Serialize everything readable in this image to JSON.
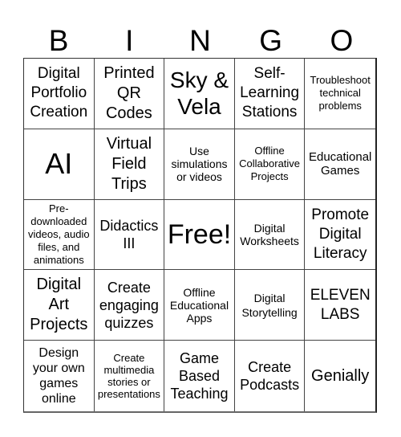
{
  "title_letters": [
    "B",
    "I",
    "N",
    "G",
    "O"
  ],
  "cells": [
    {
      "text": "Digital Portfolio Creation"
    },
    {
      "text": "Printed QR Codes"
    },
    {
      "text": "Sky & Vela"
    },
    {
      "text": "Self-Learning Stations"
    },
    {
      "text": "Troubleshoot technical problems"
    },
    {
      "text": "AI"
    },
    {
      "text": "Virtual Field Trips"
    },
    {
      "text": "Use simulations or videos"
    },
    {
      "text": "Offline Collaborative Projects"
    },
    {
      "text": "Educational Games"
    },
    {
      "text": "Pre-downloaded videos, audio files, and animations"
    },
    {
      "text": "Didactics III"
    },
    {
      "text": "Free!"
    },
    {
      "text": "Digital Worksheets"
    },
    {
      "text": "Promote Digital Literacy"
    },
    {
      "text": "Digital Art Projects"
    },
    {
      "text": "Create engaging quizzes"
    },
    {
      "text": "Offline Educational Apps"
    },
    {
      "text": "Digital Storytelling"
    },
    {
      "text": "ELEVEN LABS"
    },
    {
      "text": "Design your own games online"
    },
    {
      "text": "Create multimedia stories or presentations"
    },
    {
      "text": "Game Based Teaching"
    },
    {
      "text": "Create Podcasts"
    },
    {
      "text": "Genially"
    }
  ]
}
